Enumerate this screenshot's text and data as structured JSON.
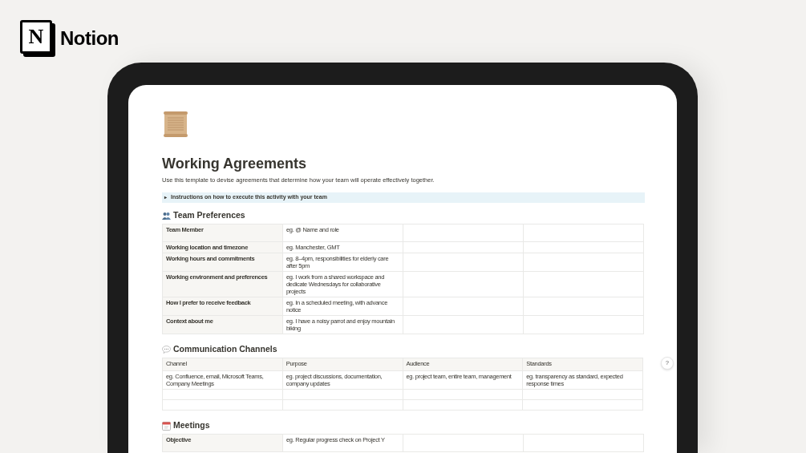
{
  "brand": {
    "mark": "N",
    "name": "Notion"
  },
  "page": {
    "title": "Working Agreements",
    "description": "Use this template to devise agreements that determine how your team will operate effectively together.",
    "callout": {
      "toggle": "▸",
      "text": "Instructions on how to execute this activity with your team",
      "expanded": false
    }
  },
  "sections": [
    {
      "kind": "row-headers",
      "heading": "Team Preferences",
      "rows": [
        {
          "header": "Team Member",
          "cells": [
            "eg. @ Name and role",
            "",
            ""
          ]
        },
        {
          "header": "Working location and timezone",
          "cells": [
            "eg. Manchester, GMT",
            "",
            ""
          ]
        },
        {
          "header": "Working hours and commitments",
          "cells": [
            "eg. 8–4pm, responsibilities for elderly care after 5pm",
            "",
            ""
          ]
        },
        {
          "header": "Working environment and preferences",
          "cells": [
            "eg. I work from a shared workspace and dedicate Wednesdays for collaborative projects",
            "",
            ""
          ]
        },
        {
          "header": "How I prefer to receive feedback",
          "cells": [
            "eg. In a scheduled meeting, with advance notice",
            "",
            ""
          ]
        },
        {
          "header": "Context about me",
          "cells": [
            "eg. I have a noisy parrot and enjoy mountain biking",
            "",
            ""
          ]
        }
      ]
    },
    {
      "kind": "column-headers",
      "heading": "Communication Channels",
      "columns": [
        "Channel",
        "Purpose",
        "Audience",
        "Standards"
      ],
      "rows": [
        [
          "eg. Confluence, email, Microsoft Teams, Company Meetings",
          "eg. project discussions, documentation, company updates",
          "eg. project team, entire team, management",
          "eg. transparency as standard, expected response times"
        ],
        [
          "",
          "",
          "",
          ""
        ],
        [
          "",
          "",
          "",
          ""
        ]
      ]
    },
    {
      "kind": "row-headers",
      "heading": "Meetings",
      "rows": [
        {
          "header": "Objective",
          "cells": [
            "eg. Regular progress check on Project Y",
            "",
            ""
          ]
        }
      ]
    }
  ],
  "help": {
    "label": "?"
  }
}
